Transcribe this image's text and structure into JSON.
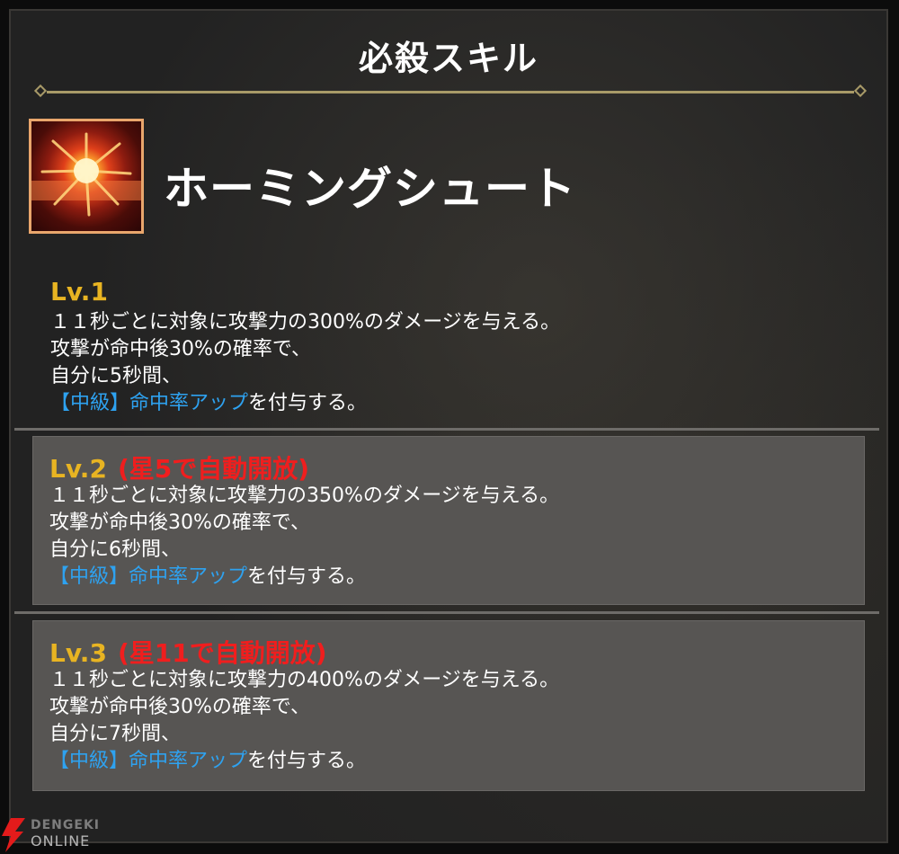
{
  "header": {
    "title": "必殺スキル"
  },
  "skill": {
    "name": "ホーミングシュート",
    "icon": "explosion-icon"
  },
  "levels": [
    {
      "label": "Lv.1",
      "unlock": "",
      "lines": [
        "１１秒ごとに対象に攻撃力の300%のダメージを与える。",
        "攻撃が命中後30%の確率で、",
        "自分に5秒間、"
      ],
      "buff": "【中級】命中率アップ",
      "buff_suffix": "を付与する。"
    },
    {
      "label": "Lv.2",
      "unlock": "(星5で自動開放)",
      "lines": [
        "１１秒ごとに対象に攻撃力の350%のダメージを与える。",
        "攻撃が命中後30%の確率で、",
        "自分に6秒間、"
      ],
      "buff": "【中級】命中率アップ",
      "buff_suffix": "を付与する。"
    },
    {
      "label": "Lv.3",
      "unlock": "(星11で自動開放)",
      "lines": [
        "１１秒ごとに対象に攻撃力の400%のダメージを与える。",
        "攻撃が命中後30%の確率で、",
        "自分に7秒間、"
      ],
      "buff": "【中級】命中率アップ",
      "buff_suffix": "を付与する。"
    }
  ],
  "watermark": {
    "top": "DENGEKI",
    "bottom": "ONLINE"
  },
  "colors": {
    "level_label": "#e8b422",
    "unlock_text": "#f01e1e",
    "buff_text": "#2ea2f0",
    "divider": "#a89a68",
    "boxed_bg": "#575553"
  }
}
